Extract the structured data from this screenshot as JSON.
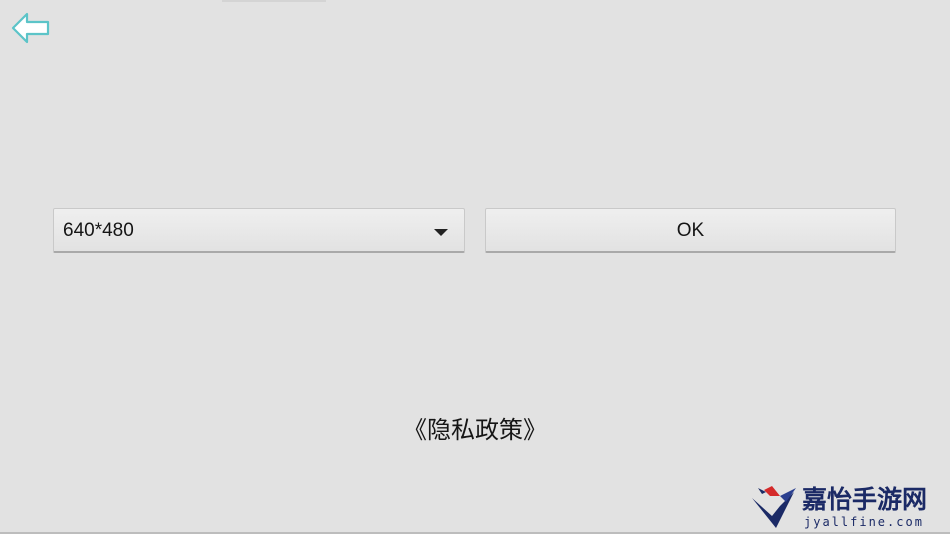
{
  "resolution": {
    "selected": "640*480"
  },
  "buttons": {
    "ok_label": "OK"
  },
  "privacy": {
    "link_text": "《隐私政策》"
  },
  "watermark": {
    "name": "嘉怡手游网",
    "url": "jyallfine.com"
  },
  "colors": {
    "background": "#e2e2e2",
    "back_icon": "#5cc4c8",
    "watermark_blue": "#1b2a66",
    "watermark_red": "#d42a2a"
  },
  "icons": {
    "back": "arrow-left-icon",
    "dropdown": "triangle-down-icon",
    "logo": "bird-logo-icon"
  }
}
